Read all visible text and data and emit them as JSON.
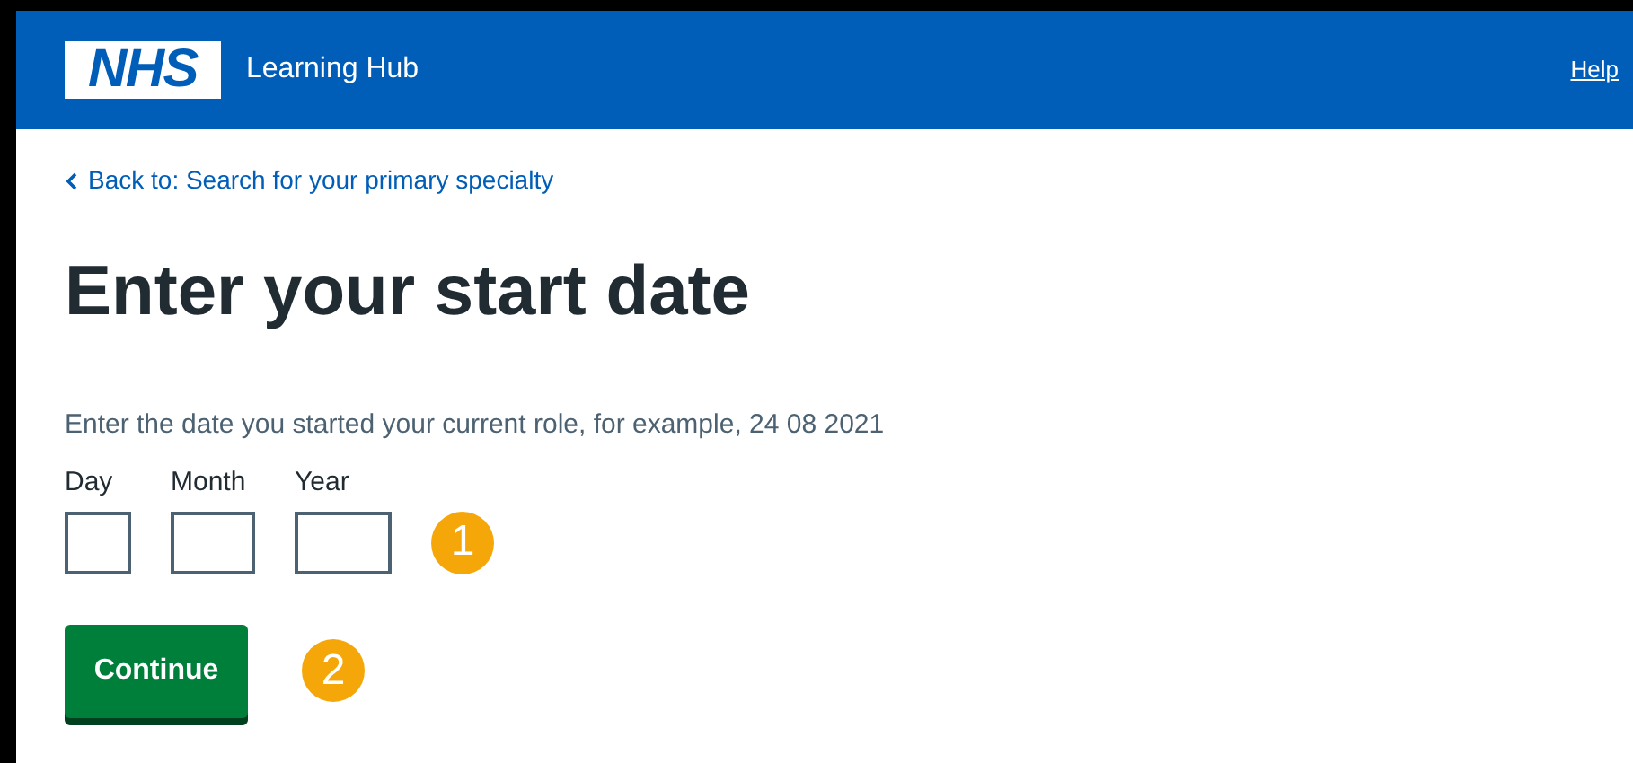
{
  "header": {
    "logo": "NHS",
    "service_name": "Learning Hub",
    "help_link": "Help"
  },
  "back_link": "Back to: Search for your primary specialty",
  "heading": "Enter your start date",
  "hint": "Enter the date you started your current role, for example, 24 08 2021",
  "date_fields": [
    {
      "label": "Day"
    },
    {
      "label": "Month"
    },
    {
      "label": "Year"
    }
  ],
  "date_callout": "1",
  "continue_button": "Continue",
  "button_callout": "2"
}
